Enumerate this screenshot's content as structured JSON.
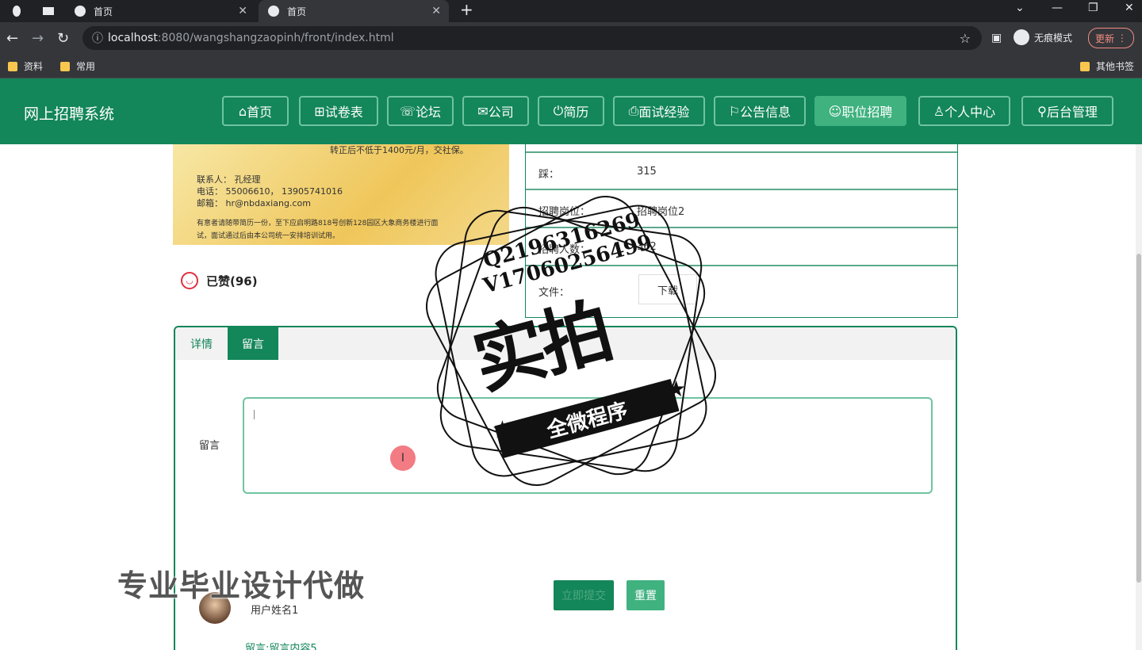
{
  "browser": {
    "tabs": [
      {
        "title": "首页"
      },
      {
        "title": "首页"
      }
    ],
    "url_host": "localhost",
    "url_path": ":8080/wangshangzaopinh/front/index.html",
    "incognito_label": "无痕模式",
    "update_label": "更新",
    "bookmarks": [
      "资料",
      "常用"
    ],
    "other_bookmarks": "其他书签"
  },
  "site": {
    "title": "网上招聘系统",
    "nav": [
      "首页",
      "试卷表",
      "论坛",
      "公司",
      "简历",
      "面试经验",
      "公告信息",
      "职位招聘",
      "个人中心",
      "后台管理"
    ],
    "active_nav": "职位招聘"
  },
  "poster": {
    "line1": "转正后不低于1400元/月，交社保。",
    "contact": "联系人：  孔经理",
    "phone": "电话：  55006610， 13905741016",
    "email": "邮箱：  hr@nbdaxiang.com",
    "note1": "有意者请随带简历一份，至下应启明路818号创新128园区大象商务楼进行面",
    "note2": "试，面试通过后由本公司统一安排培训试用。"
  },
  "like": {
    "label": "已赞(96)"
  },
  "info": {
    "rows": [
      {
        "key": "踩：",
        "value": "315"
      },
      {
        "key": "招聘岗位：",
        "value": "招聘岗位2"
      },
      {
        "key": "招聘人数：",
        "value": "362"
      }
    ],
    "file_key": "文件：",
    "download_label": "下载"
  },
  "panel": {
    "tabs": [
      "详情",
      "留言"
    ],
    "active_tab": "留言",
    "message_label": "留言",
    "submit_label": "立即提交",
    "reset_label": "重置",
    "comment_user": "用户姓名1",
    "comment_content": "留言:留言内容5"
  },
  "watermark": {
    "line1": "Q2196316269",
    "line2": "V17060256499",
    "big": "实拍",
    "banner": "全微程序",
    "overlay": "专业毕业设计代做"
  },
  "colors": {
    "primary": "#13865a",
    "active": "#3fb27f"
  }
}
